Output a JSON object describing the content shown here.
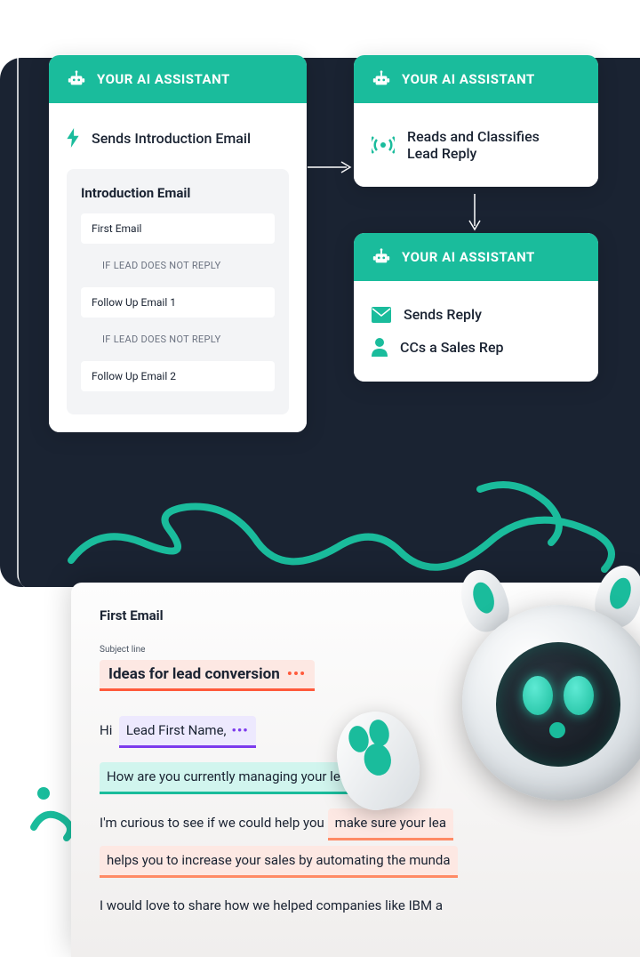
{
  "assistant_label": "YOUR AI ASSISTANT",
  "card1": {
    "action": "Sends Introduction Email",
    "section_title": "Introduction Email",
    "items": [
      {
        "type": "email",
        "label": "First Email"
      },
      {
        "type": "cond",
        "label": "IF LEAD DOES NOT REPLY"
      },
      {
        "type": "email",
        "label": "Follow Up Email 1"
      },
      {
        "type": "cond",
        "label": "IF LEAD DOES NOT REPLY"
      },
      {
        "type": "email",
        "label": "Follow Up Email 2"
      }
    ]
  },
  "card2": {
    "action": "Reads and Classifies Lead Reply"
  },
  "card3": {
    "action1": "Sends Reply",
    "action2": "CCs a Sales Rep"
  },
  "email_editor": {
    "title": "First Email",
    "subject_label": "Subject line",
    "subject": "Ideas for lead conversion",
    "greeting_prefix": "Hi",
    "greeting_token": "Lead First Name,",
    "question_token": "How are you currently managing your lead",
    "line2_prefix": "I'm curious to see if we could help you",
    "line2_token": "make sure your lea",
    "line3_token": "helps you to increase your sales by automating the munda",
    "line4": "I would love to share how we helped companies like IBM a"
  }
}
